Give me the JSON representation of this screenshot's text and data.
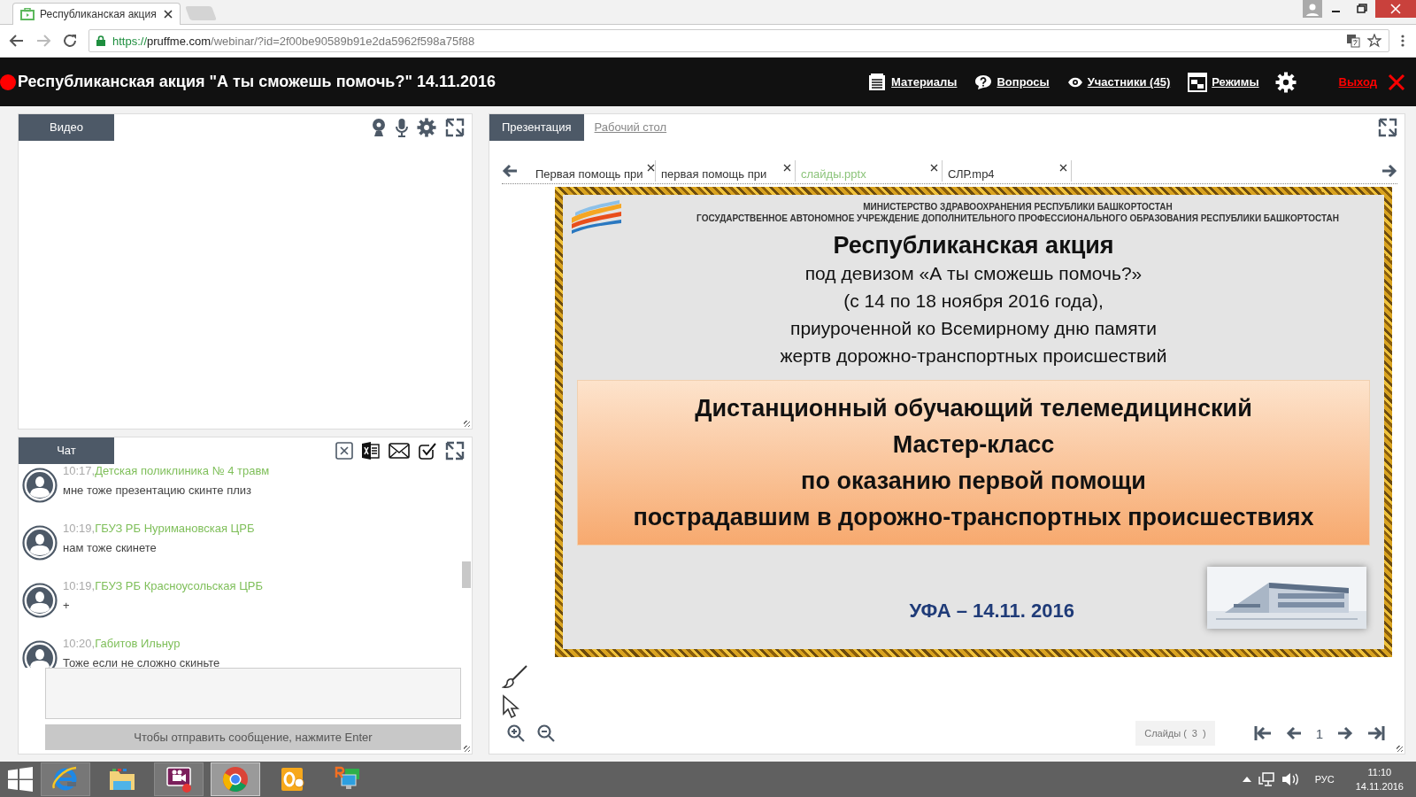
{
  "browser": {
    "tabs": [
      {
        "title": "Республиканская акция",
        "selected": true
      }
    ],
    "address_bar": {
      "scheme": "https://",
      "host": "pruffme.com",
      "path": "/webinar/?id=2f00be90589b91e2da5962f598a75f88"
    }
  },
  "header": {
    "live": true,
    "title": "Республиканская акция \"А ты сможешь помочь?\" 14.11.2016",
    "nav": [
      {
        "kind": "materials",
        "label": "Материалы"
      },
      {
        "kind": "questions",
        "label": "Вопросы"
      },
      {
        "kind": "participants",
        "label": "Участники (45)"
      },
      {
        "kind": "modes",
        "label": "Режимы"
      }
    ],
    "exit": "Выход"
  },
  "video_panel": {
    "tab": "Видео"
  },
  "chat": {
    "tab": "Чат",
    "messages": [
      {
        "time": "10:17,",
        "author": "Детская поликлиника № 4 травм",
        "text": "мне тоже презентацию скинте плиз"
      },
      {
        "time": "10:19,",
        "author": "ГБУЗ РБ Нуримановская ЦРБ",
        "text": "нам тоже скинете"
      },
      {
        "time": "10:19,",
        "author": "ГБУЗ РБ Красноусольская ЦРБ",
        "text": "+"
      },
      {
        "time": "10:20,",
        "author": "Габитов Ильнур",
        "text": "Тоже если не сложно скиньте"
      }
    ],
    "send_hint": "Чтобы отправить сообщение, нажмите Enter"
  },
  "presentation": {
    "tabs": [
      {
        "label": "Презентация",
        "selected": true
      },
      {
        "label": "Рабочий стол",
        "selected": false
      }
    ],
    "files": [
      {
        "name": "Первая помощь при",
        "selected": false
      },
      {
        "name": "первая помощь при",
        "selected": false
      },
      {
        "name": "слайды.pptx",
        "selected": true
      },
      {
        "name": "СЛР.mp4",
        "selected": false
      }
    ],
    "slide": {
      "org_lines": [
        "МИНИСТЕРСТВО ЗДРАВООХРАНЕНИЯ РЕСПУБЛИКИ БАШКОРТОСТАН",
        "ГОСУДАРСТВЕННОЕ АВТОНОМНОЕ УЧРЕЖДЕНИЕ ДОПОЛНИТЕЛЬНОГО ПРОФЕССИОНАЛЬНОГО ОБРАЗОВАНИЯ РЕСПУБЛИКИ БАШКОРТОСТАН"
      ],
      "title": "Республиканская акция",
      "subtitle_lines": [
        "под девизом «А ты сможешь помочь?»",
        "(с 14 по 18 ноября 2016 года),",
        "приуроченной ко Всемирному дню памяти",
        "жертв дорожно-транспортных происшествий"
      ],
      "banner_lines": [
        "Дистанционный обучающий телемедицинский",
        "Мастер-класс",
        "по оказанию первой помощи",
        "пострадавшим в дорожно-транспортных происшествиях"
      ],
      "footer": "УФА – 14.11. 2016"
    },
    "slides_label": "Слайды (",
    "slides_count": "3",
    "slides_close": ")",
    "page": "1"
  },
  "taskbar": {
    "apps": [
      {
        "kind": "ie",
        "running": true,
        "selected": false
      },
      {
        "kind": "explorer",
        "running": false,
        "selected": false
      },
      {
        "kind": "video",
        "running": true,
        "selected": false
      },
      {
        "kind": "chrome",
        "running": true,
        "selected": true
      },
      {
        "kind": "outlook",
        "running": false,
        "selected": false
      },
      {
        "kind": "remote",
        "running": false,
        "selected": false
      }
    ],
    "language": "РУС",
    "time": "11:10",
    "date": "14.11.2016"
  }
}
